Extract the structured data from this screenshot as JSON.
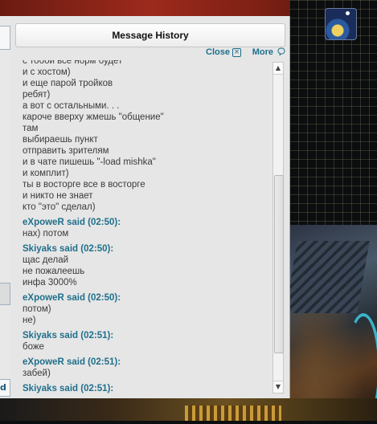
{
  "window": {
    "title": "Message History",
    "close_label": "Close",
    "more_label": "More"
  },
  "left_window": {
    "partial_label": "d"
  },
  "icons": {
    "close": "close-box-icon",
    "more": "speech-bubble-icon",
    "scroll_up": "arrow-up-icon",
    "scroll_down": "arrow-down-icon"
  },
  "colors": {
    "sender": "#1f6f8b",
    "text": "#3a3a3a",
    "window_bg": "#e6e6e6"
  },
  "messages": [
    {
      "sender": "",
      "lines": [
        "с тобой все норм будет",
        "и с хостом)",
        "и еще парой тройков",
        "ребят)",
        "а вот с остальными. . .",
        "кароче вверху жмешь \"общение\"",
        "там",
        "выбираешь пункт",
        "отправить зрителям",
        "и в чате пишешь \"-load mishka\"",
        "и комплит)",
        "ты в восторге все в восторге",
        "и никто не знает",
        "кто \"это\" сделал)"
      ]
    },
    {
      "sender": "eXpoweR said (02:50):",
      "lines": [
        "нах) потом"
      ]
    },
    {
      "sender": "Skiyaks said (02:50):",
      "lines": [
        "щас делай",
        "не пожалеешь",
        "инфа 3000%"
      ]
    },
    {
      "sender": "eXpoweR said (02:50):",
      "lines": [
        "потом)",
        "не)"
      ]
    },
    {
      "sender": "Skiyaks said (02:51):",
      "lines": [
        "боже"
      ]
    },
    {
      "sender": "eXpoweR said (02:51):",
      "lines": [
        "забей)"
      ]
    },
    {
      "sender": "Skiyaks said (02:51):",
      "lines": []
    }
  ]
}
